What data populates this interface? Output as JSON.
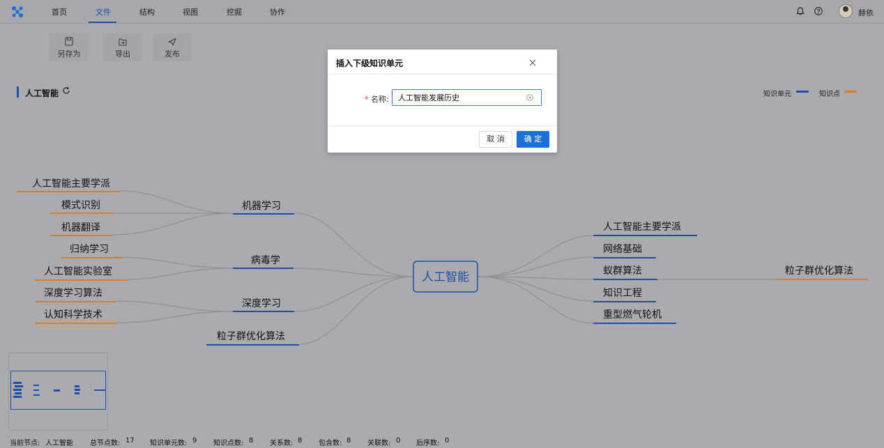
{
  "nav": {
    "tabs": [
      "首页",
      "文件",
      "结构",
      "视图",
      "挖掘",
      "协作"
    ],
    "active_tab": "文件",
    "username": "赫依"
  },
  "toolbar": {
    "items": [
      {
        "label": "另存为",
        "icon": "save-as-icon"
      },
      {
        "label": "导出",
        "icon": "export-icon"
      },
      {
        "label": "发布",
        "icon": "publish-icon"
      }
    ]
  },
  "canvas": {
    "title": "人工智能",
    "legend": [
      {
        "label": "知识单元",
        "color": "#1b4fa8"
      },
      {
        "label": "知识点",
        "color": "#e07b22"
      }
    ]
  },
  "mindmap": {
    "center": "人工智能",
    "left_branches": [
      {
        "label": "机器学习",
        "children": [
          "人工智能主要学派",
          "模式识别",
          "机器翻译"
        ]
      },
      {
        "label": "病毒学",
        "children": [
          "归纳学习",
          "人工智能实验室"
        ]
      },
      {
        "label": "深度学习",
        "children": [
          "深度学习算法",
          "认知科学技术"
        ]
      },
      {
        "label": "粒子群优化算法",
        "children": []
      }
    ],
    "right_branches": [
      {
        "label": "人工智能主要学派",
        "children": []
      },
      {
        "label": "网络基础",
        "children": []
      },
      {
        "label": "蚁群算法",
        "children": [
          "粒子群优化算法"
        ]
      },
      {
        "label": "知识工程",
        "children": []
      },
      {
        "label": "重型燃气轮机",
        "children": []
      }
    ]
  },
  "status": {
    "current_node_label": "当前节点:",
    "current_node": "人工智能",
    "total_nodes_label": "总节点数:",
    "total_nodes": "17",
    "units_label": "知识单元数:",
    "units": "9",
    "points_label": "知识点数:",
    "points": "8",
    "relations_label": "关系数:",
    "relations": "8",
    "contains_label": "包含数:",
    "contains": "8",
    "associations_label": "关联数:",
    "associations": "0",
    "sequence_label": "后序数:",
    "sequence": "0"
  },
  "dialog": {
    "title": "插入下级知识单元",
    "field_label": "名称:",
    "field_value": "人工智能发展历史",
    "cancel_label": "取 消",
    "ok_label": "确 定"
  }
}
